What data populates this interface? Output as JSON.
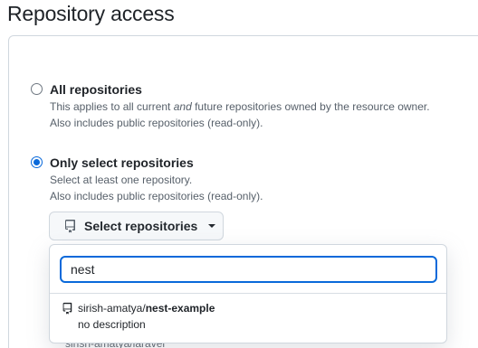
{
  "page": {
    "title": "Repository access"
  },
  "options": [
    {
      "title": "All repositories",
      "desc_line1_before": "This applies to all current ",
      "desc_line1_em": "and",
      "desc_line1_after": " future repositories owned by the resource owner.",
      "desc_line2": "Also includes public repositories (read-only).",
      "checked": false
    },
    {
      "title": "Only select repositories",
      "desc_line1": "Select at least one repository.",
      "desc_line2": "Also includes public repositories (read-only).",
      "checked": true
    }
  ],
  "select_button": {
    "label": "Select repositories",
    "icon": "repo-icon"
  },
  "dropdown": {
    "search_value": "nest",
    "results": [
      {
        "owner": "sirish-amatya/",
        "name": "nest-example",
        "description": "no description",
        "icon": "repo-icon"
      }
    ],
    "partially_hidden_row": "sirish-amatya/laravel"
  },
  "colors": {
    "accent": "#0969da",
    "border": "#d0d7de",
    "muted": "#57606a"
  }
}
